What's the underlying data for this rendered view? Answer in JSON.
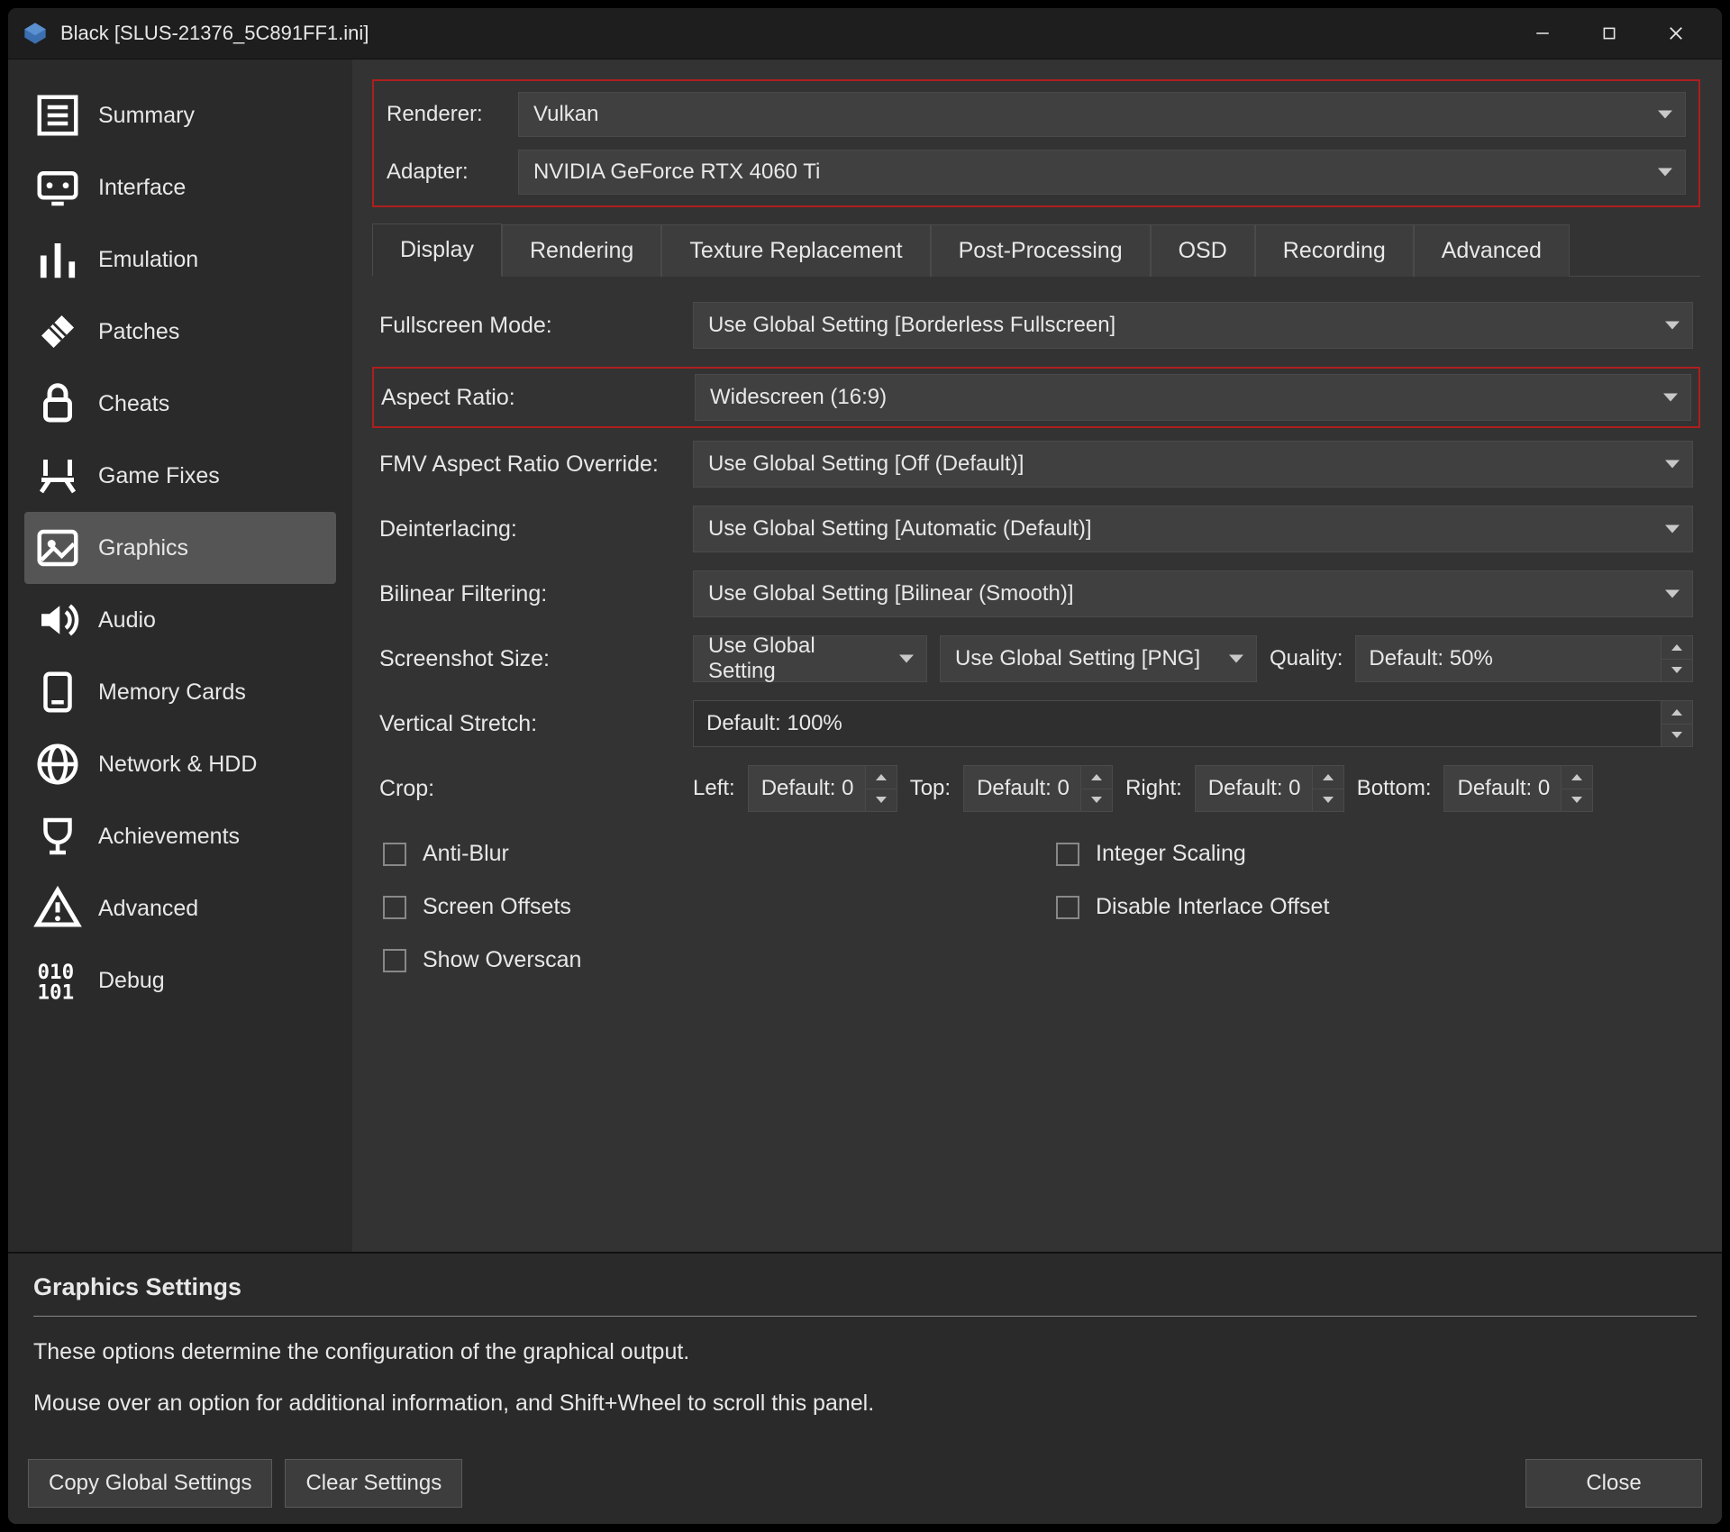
{
  "window": {
    "title": "Black [SLUS-21376_5C891FF1.ini]"
  },
  "sidebar": {
    "items": [
      {
        "label": "Summary",
        "icon": "summary"
      },
      {
        "label": "Interface",
        "icon": "interface"
      },
      {
        "label": "Emulation",
        "icon": "emulation"
      },
      {
        "label": "Patches",
        "icon": "patches"
      },
      {
        "label": "Cheats",
        "icon": "cheats"
      },
      {
        "label": "Game Fixes",
        "icon": "gamefixes"
      },
      {
        "label": "Graphics",
        "icon": "graphics",
        "selected": true
      },
      {
        "label": "Audio",
        "icon": "audio"
      },
      {
        "label": "Memory Cards",
        "icon": "memcards"
      },
      {
        "label": "Network & HDD",
        "icon": "network"
      },
      {
        "label": "Achievements",
        "icon": "achievements"
      },
      {
        "label": "Advanced",
        "icon": "advanced"
      },
      {
        "label": "Debug",
        "icon": "debug"
      }
    ]
  },
  "renderer": {
    "label": "Renderer:",
    "value": "Vulkan"
  },
  "adapter": {
    "label": "Adapter:",
    "value": "NVIDIA GeForce RTX 4060 Ti"
  },
  "tabs": [
    "Display",
    "Rendering",
    "Texture Replacement",
    "Post-Processing",
    "OSD",
    "Recording",
    "Advanced"
  ],
  "active_tab": 0,
  "display": {
    "fullscreen": {
      "label": "Fullscreen Mode:",
      "value": "Use Global Setting [Borderless Fullscreen]"
    },
    "aspect": {
      "label": "Aspect Ratio:",
      "value": "Widescreen (16:9)"
    },
    "fmv": {
      "label": "FMV Aspect Ratio Override:",
      "value": "Use Global Setting [Off (Default)]"
    },
    "deinterlace": {
      "label": "Deinterlacing:",
      "value": "Use Global Setting [Automatic (Default)]"
    },
    "bilinear": {
      "label": "Bilinear Filtering:",
      "value": "Use Global Setting [Bilinear (Smooth)]"
    },
    "sshot_size": {
      "label": "Screenshot Size:",
      "value": "Use Global Setting"
    },
    "sshot_fmt": {
      "value": "Use Global Setting [PNG]"
    },
    "quality": {
      "label": "Quality:",
      "value": "Default: 50%"
    },
    "vstretch": {
      "label": "Vertical Stretch:",
      "value": "Default: 100%"
    },
    "crop": {
      "label": "Crop:",
      "left": {
        "label": "Left:",
        "value": "Default: 0"
      },
      "top": {
        "label": "Top:",
        "value": "Default: 0"
      },
      "right": {
        "label": "Right:",
        "value": "Default: 0"
      },
      "bottom": {
        "label": "Bottom:",
        "value": "Default: 0"
      }
    },
    "checks": {
      "antiblur": {
        "label": "Anti-Blur",
        "checked": false
      },
      "integer": {
        "label": "Integer Scaling",
        "checked": false
      },
      "offsets": {
        "label": "Screen Offsets",
        "checked": false
      },
      "disable_io": {
        "label": "Disable Interlace Offset",
        "checked": false
      },
      "overscan": {
        "label": "Show Overscan",
        "checked": false
      }
    }
  },
  "help": {
    "title": "Graphics Settings",
    "line1": "These options determine the configuration of the graphical output.",
    "line2": "Mouse over an option for additional information, and Shift+Wheel to scroll this panel."
  },
  "buttons": {
    "copy": "Copy Global Settings",
    "clear": "Clear Settings",
    "close": "Close"
  }
}
